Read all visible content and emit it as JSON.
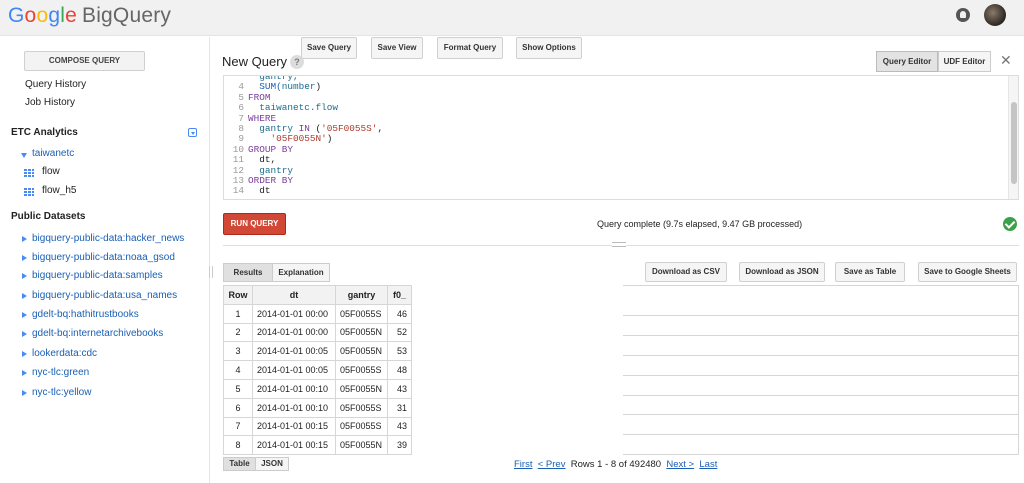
{
  "header": {
    "logo_google": [
      "G",
      "o",
      "o",
      "g",
      "l",
      "e"
    ],
    "logo_product": "BigQuery"
  },
  "sidebar": {
    "compose_label": "COMPOSE QUERY",
    "query_history": "Query History",
    "job_history": "Job History",
    "etc_section": "ETC Analytics",
    "dataset": "taiwanetc",
    "tables": [
      "flow",
      "flow_h5"
    ],
    "public_section": "Public Datasets",
    "public_datasets": [
      "bigquery-public-data:hacker_news",
      "bigquery-public-data:noaa_gsod",
      "bigquery-public-data:samples",
      "bigquery-public-data:usa_names",
      "gdelt-bq:hathitrustbooks",
      "gdelt-bq:internetarchivebooks",
      "lookerdata:cdc",
      "nyc-tlc:green",
      "nyc-tlc:yellow"
    ]
  },
  "main": {
    "title": "New Query",
    "help": "?",
    "tabs": [
      "Query Editor",
      "UDF Editor"
    ],
    "close": "✕",
    "editor_lines": [
      {
        "n": "",
        "tokens": [
          {
            "t": "  gantry,",
            "c": "id"
          }
        ]
      },
      {
        "n": "4",
        "tokens": [
          {
            "t": "  SUM(",
            "c": "fn"
          },
          {
            "t": "number",
            "c": "id"
          },
          {
            "t": ")",
            "c": "pl"
          }
        ]
      },
      {
        "n": "5",
        "tokens": [
          {
            "t": "FROM",
            "c": "kw"
          }
        ]
      },
      {
        "n": "6",
        "tokens": [
          {
            "t": "  taiwanetc.flow",
            "c": "id"
          }
        ]
      },
      {
        "n": "7",
        "tokens": [
          {
            "t": "WHERE",
            "c": "kw"
          }
        ]
      },
      {
        "n": "8",
        "tokens": [
          {
            "t": "  gantry ",
            "c": "id"
          },
          {
            "t": "IN",
            "c": "kw"
          },
          {
            "t": " (",
            "c": "pl"
          },
          {
            "t": "'05F0055S'",
            "c": "str"
          },
          {
            "t": ",",
            "c": "pl"
          }
        ]
      },
      {
        "n": "9",
        "tokens": [
          {
            "t": "    ",
            "c": "pl"
          },
          {
            "t": "'05F0055N'",
            "c": "str"
          },
          {
            "t": ")",
            "c": "pl"
          }
        ]
      },
      {
        "n": "10",
        "tokens": [
          {
            "t": "GROUP BY",
            "c": "kw"
          }
        ]
      },
      {
        "n": "11",
        "tokens": [
          {
            "t": "  dt,",
            "c": "pl"
          }
        ]
      },
      {
        "n": "12",
        "tokens": [
          {
            "t": "  gantry",
            "c": "id"
          }
        ]
      },
      {
        "n": "13",
        "tokens": [
          {
            "t": "ORDER BY",
            "c": "kw"
          }
        ]
      },
      {
        "n": "14",
        "tokens": [
          {
            "t": "  dt",
            "c": "pl"
          }
        ]
      }
    ],
    "run_label": "RUN QUERY",
    "actions": [
      "Save Query",
      "Save View",
      "Format Query",
      "Show Options"
    ],
    "status": "Query complete (9.7s elapsed, 9.47 GB processed)",
    "result_tabs": [
      "Results",
      "Explanation"
    ],
    "downloads": [
      "Download as CSV",
      "Download as JSON",
      "Save as Table",
      "Save to Google Sheets"
    ],
    "columns": [
      "Row",
      "dt",
      "gantry",
      "f0_"
    ],
    "rows": [
      [
        "1",
        "2014-01-01 00:00",
        "05F0055S",
        "46"
      ],
      [
        "2",
        "2014-01-01 00:00",
        "05F0055N",
        "52"
      ],
      [
        "3",
        "2014-01-01 00:05",
        "05F0055N",
        "53"
      ],
      [
        "4",
        "2014-01-01 00:05",
        "05F0055S",
        "48"
      ],
      [
        "5",
        "2014-01-01 00:10",
        "05F0055N",
        "43"
      ],
      [
        "6",
        "2014-01-01 00:10",
        "05F0055S",
        "31"
      ],
      [
        "7",
        "2014-01-01 00:15",
        "05F0055S",
        "43"
      ],
      [
        "8",
        "2014-01-01 00:15",
        "05F0055N",
        "39"
      ]
    ],
    "views": [
      "Table",
      "JSON"
    ],
    "pager": {
      "first": "First",
      "prev": "< Prev",
      "summary": "Rows 1 - 8 of 492480",
      "next": "Next >",
      "last": "Last"
    }
  }
}
